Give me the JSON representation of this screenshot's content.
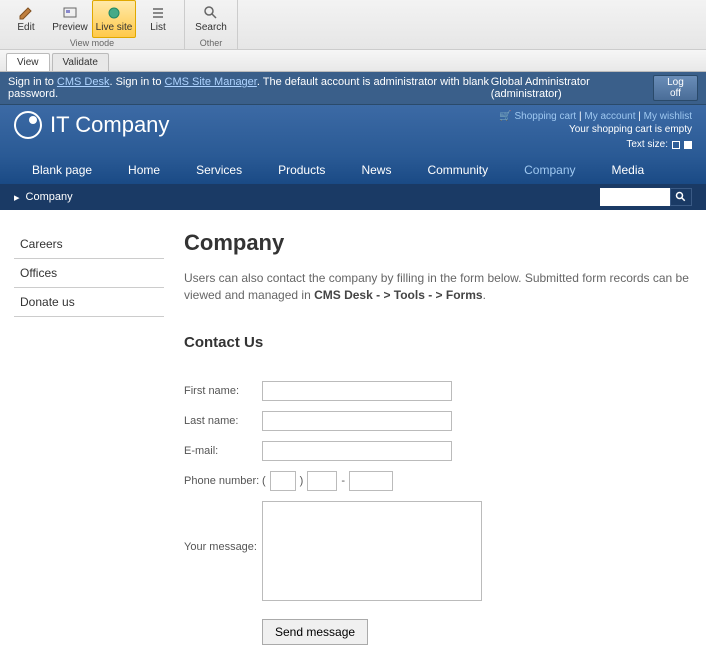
{
  "ribbon": {
    "group1_label": "View mode",
    "group2_label": "Other",
    "edit": "Edit",
    "preview": "Preview",
    "livesite": "Live site",
    "list": "List",
    "search": "Search"
  },
  "tabs": {
    "view": "View",
    "validate": "Validate"
  },
  "signin": {
    "pre1": "Sign in to ",
    "link1": "CMS Desk",
    "mid": ". Sign in to ",
    "link2": "CMS Site Manager",
    "post": ". The default account is administrator with blank password.",
    "user": "Global Administrator (administrator)",
    "logoff": "Log off"
  },
  "header": {
    "site_name": "IT Company",
    "cart_link": "Shopping cart",
    "account_link": "My account",
    "wishlist_link": "My wishlist",
    "cart_empty": "Your shopping cart is empty",
    "textsize_label": "Text size:"
  },
  "nav": {
    "items": [
      "Blank page",
      "Home",
      "Services",
      "Products",
      "News",
      "Community",
      "Company",
      "Media"
    ],
    "active_index": 6
  },
  "breadcrumb": {
    "arrow": "▸",
    "current": "Company"
  },
  "sidebar": {
    "items": [
      "Careers",
      "Offices",
      "Donate us"
    ]
  },
  "page": {
    "title": "Company",
    "intro_a": "Users can also contact the company by filling in the form below. Submitted form records can be viewed and managed in ",
    "intro_b": "CMS Desk - > Tools - > Forms",
    "intro_c": ".",
    "section": "Contact Us"
  },
  "form": {
    "first_name": "First name:",
    "last_name": "Last name:",
    "email": "E-mail:",
    "phone": "Phone number:",
    "message": "Your message:",
    "submit": "Send message"
  }
}
